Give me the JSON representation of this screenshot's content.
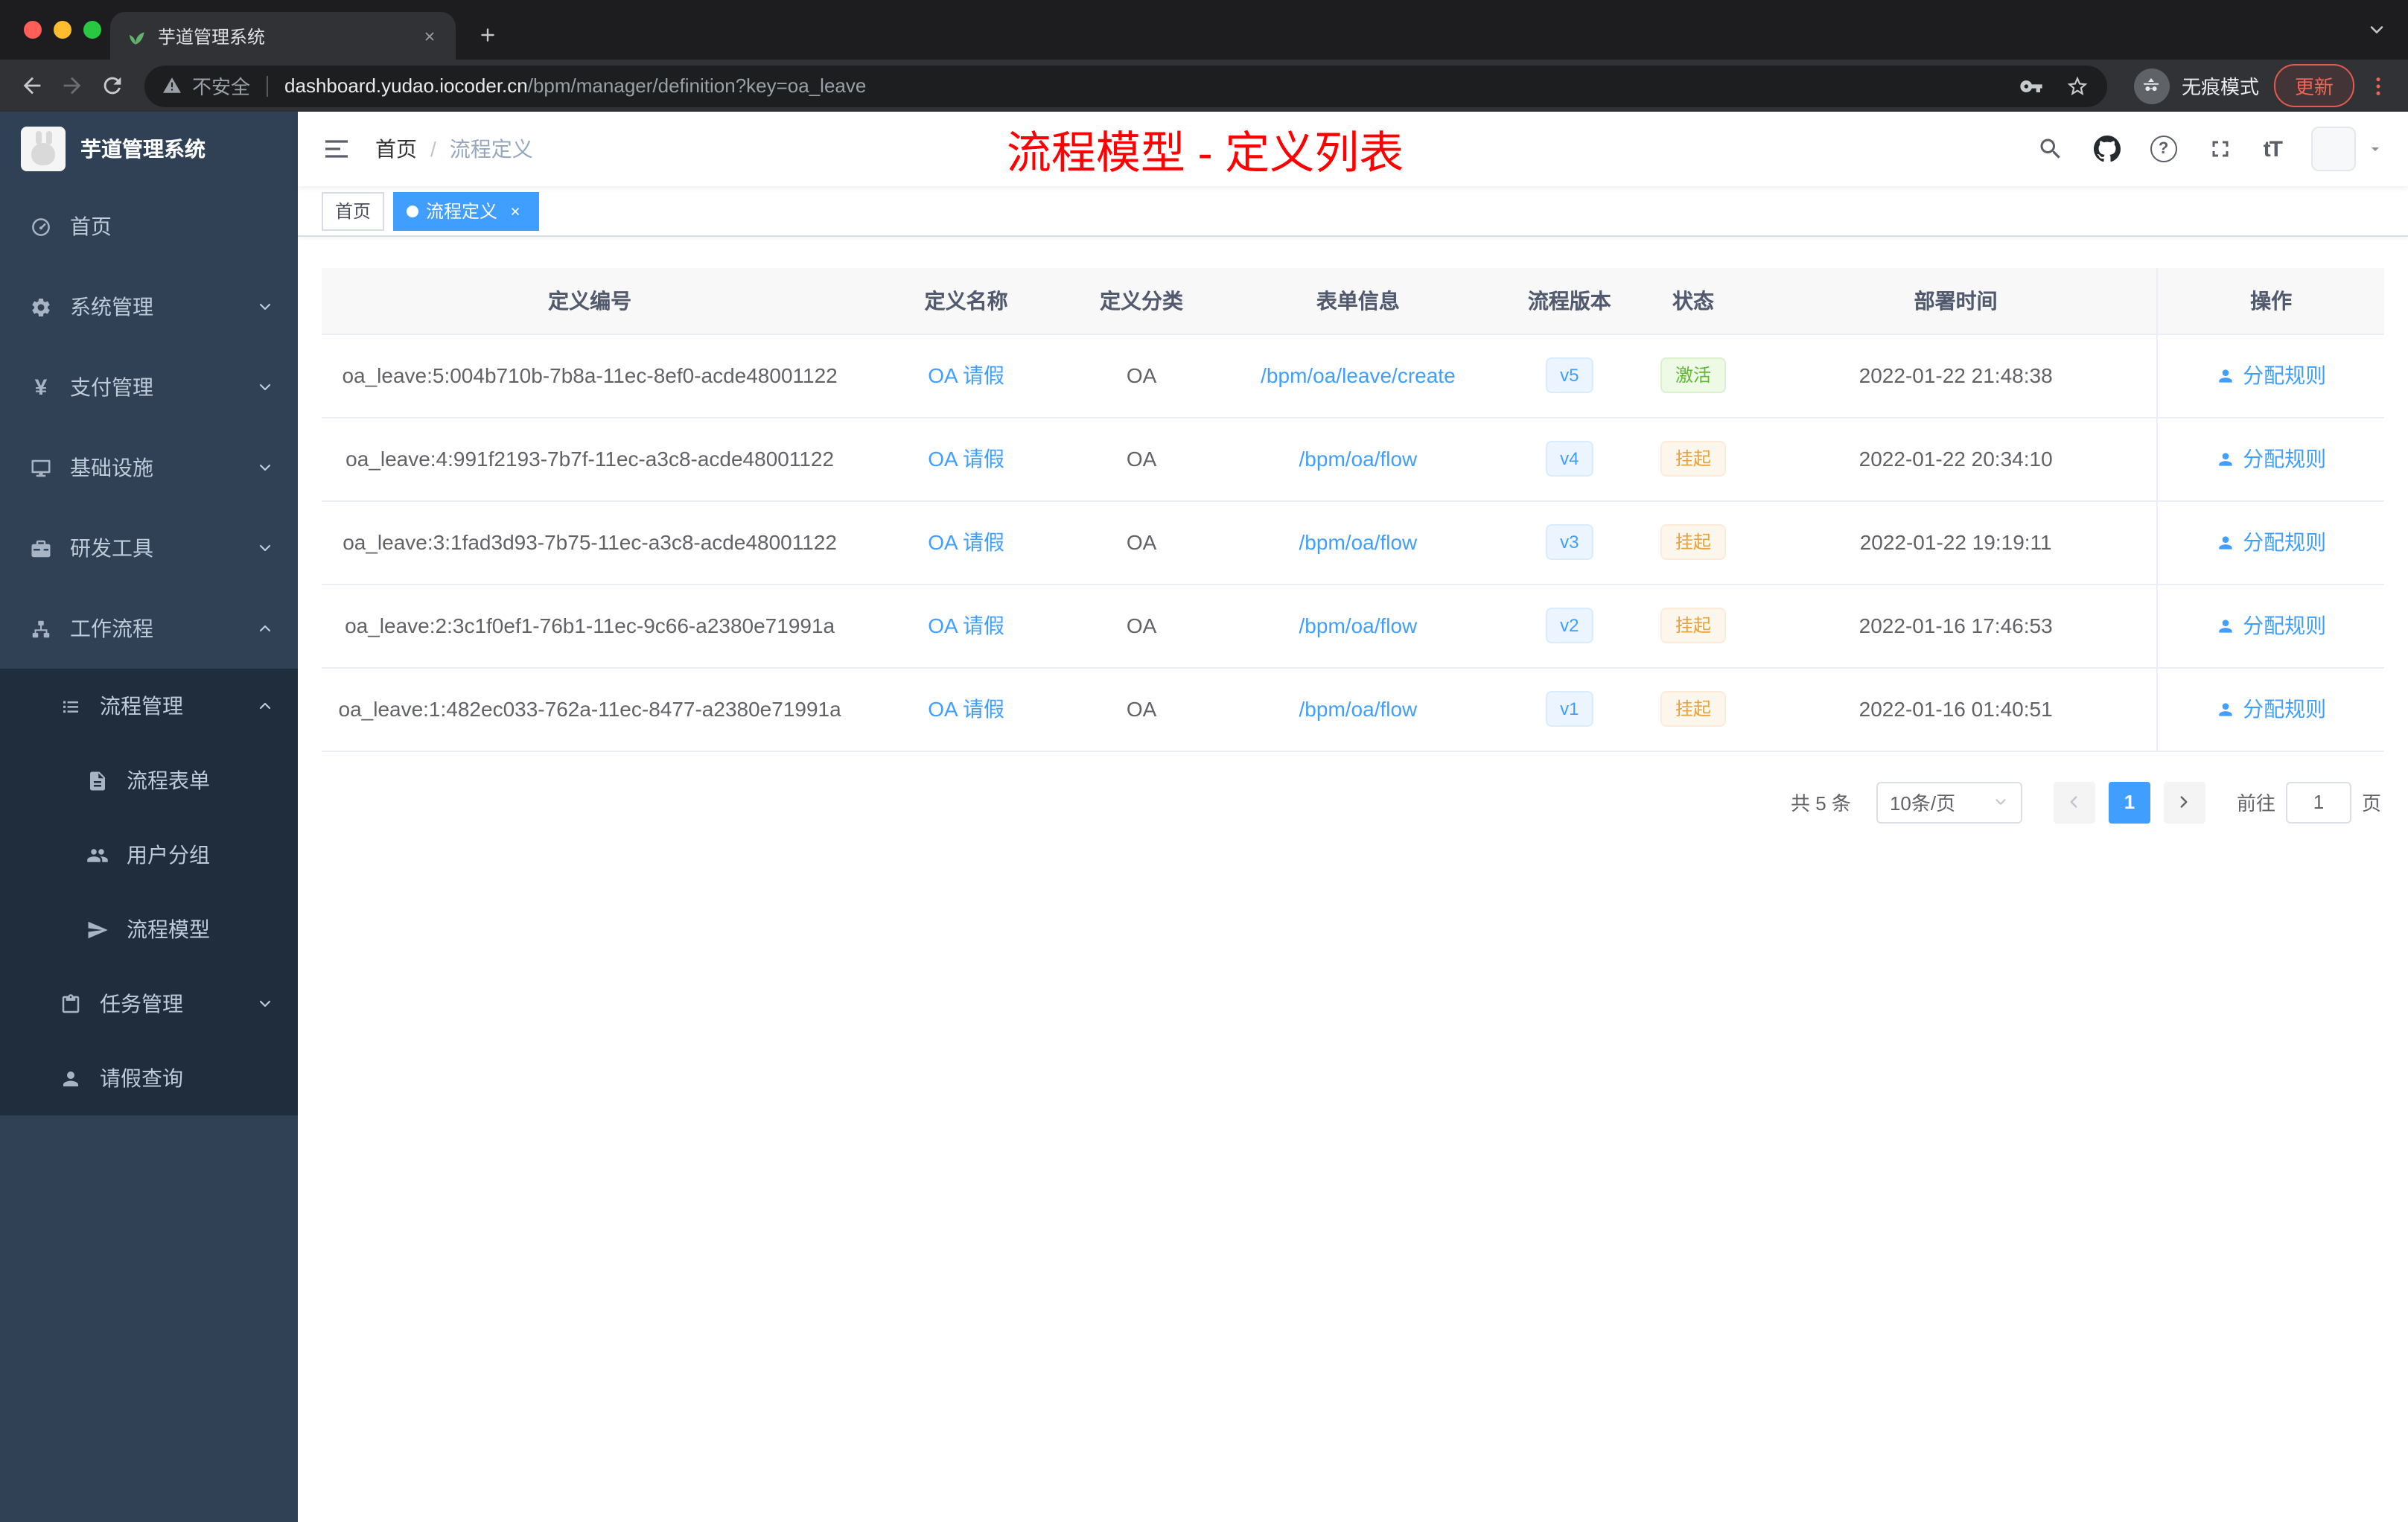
{
  "browser": {
    "tab_title": "芋道管理系统",
    "security_label": "不安全",
    "url_host": "dashboard.yudao.iocoder.cn",
    "url_path": "/bpm/manager/definition?key=oa_leave",
    "incognito_label": "无痕模式",
    "update_label": "更新"
  },
  "sidebar": {
    "logo_title": "芋道管理系统",
    "items": [
      {
        "label": "首页"
      },
      {
        "label": "系统管理"
      },
      {
        "label": "支付管理"
      },
      {
        "label": "基础设施"
      },
      {
        "label": "研发工具"
      },
      {
        "label": "工作流程"
      }
    ],
    "nested": {
      "process_management": "流程管理",
      "process_form": "流程表单",
      "user_group": "用户分组",
      "process_model": "流程模型",
      "task_management": "任务管理",
      "leave_query": "请假查询"
    }
  },
  "navbar": {
    "breadcrumb_home": "首页",
    "breadcrumb_separator": "/",
    "breadcrumb_current": "流程定义",
    "help_glyph": "?",
    "font_size_glyph": "tT"
  },
  "annotation": {
    "text": "流程模型 - 定义列表",
    "color": "#ff0000"
  },
  "tags": {
    "home": "首页",
    "current": "流程定义"
  },
  "table": {
    "columns": [
      "定义编号",
      "定义名称",
      "定义分类",
      "表单信息",
      "流程版本",
      "状态",
      "部署时间",
      "操作"
    ],
    "rows": [
      {
        "id": "oa_leave:5:004b710b-7b8a-11ec-8ef0-acde48001122",
        "name": "OA 请假",
        "category": "OA",
        "form": "/bpm/oa/leave/create",
        "version": "v5",
        "status": "激活",
        "deploy_time": "2022-01-22 21:48:38",
        "action": "分配规则"
      },
      {
        "id": "oa_leave:4:991f2193-7b7f-11ec-a3c8-acde48001122",
        "name": "OA 请假",
        "category": "OA",
        "form": "/bpm/oa/flow",
        "version": "v4",
        "status": "挂起",
        "deploy_time": "2022-01-22 20:34:10",
        "action": "分配规则"
      },
      {
        "id": "oa_leave:3:1fad3d93-7b75-11ec-a3c8-acde48001122",
        "name": "OA 请假",
        "category": "OA",
        "form": "/bpm/oa/flow",
        "version": "v3",
        "status": "挂起",
        "deploy_time": "2022-01-22 19:19:11",
        "action": "分配规则"
      },
      {
        "id": "oa_leave:2:3c1f0ef1-76b1-11ec-9c66-a2380e71991a",
        "name": "OA 请假",
        "category": "OA",
        "form": "/bpm/oa/flow",
        "version": "v2",
        "status": "挂起",
        "deploy_time": "2022-01-16 17:46:53",
        "action": "分配规则"
      },
      {
        "id": "oa_leave:1:482ec033-762a-11ec-8477-a2380e71991a",
        "name": "OA 请假",
        "category": "OA",
        "form": "/bpm/oa/flow",
        "version": "v1",
        "status": "挂起",
        "deploy_time": "2022-01-16 01:40:51",
        "action": "分配规则"
      }
    ]
  },
  "pagination": {
    "total_label": "共 5 条",
    "page_size_label": "10条/页",
    "current_page": "1",
    "goto_label": "前往",
    "goto_value": "1",
    "unit_label": "页"
  },
  "colors": {
    "accent_blue": "#409eff",
    "success_green": "#67c23a",
    "warning_orange": "#e6a23c",
    "annotation_red": "#ff0000",
    "sidebar_bg": "#304156",
    "submenu_bg": "#1f2d3d"
  }
}
